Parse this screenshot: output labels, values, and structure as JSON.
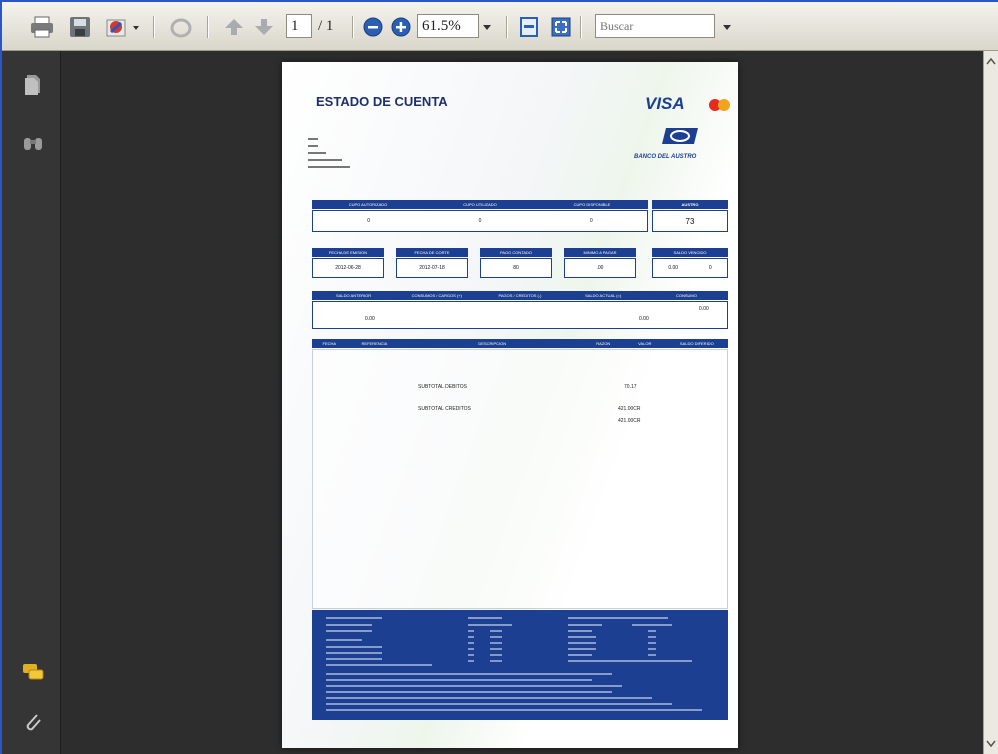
{
  "toolbar": {
    "page_current": "1",
    "page_total": "/ 1",
    "zoom": "61.5%",
    "search_placeholder": "Buscar"
  },
  "icons": {
    "print": "print-icon",
    "save": "save-icon",
    "sign": "sign-icon",
    "nav_prev": "arrow-up-icon",
    "nav_next": "arrow-down-icon",
    "zoom_out": "zoom-out-icon",
    "zoom_in": "zoom-in-icon",
    "fit_page": "fit-page-icon",
    "fullscreen": "fullscreen-icon",
    "pages": "pages-icon",
    "bookmarks": "binoculars-icon",
    "comments": "comments-icon",
    "attachments": "paperclip-icon"
  },
  "document": {
    "title": "ESTADO DE CUENTA",
    "brand_visa": "VISA",
    "bank_name": "BANCO DEL AUSTRO",
    "austro_label": "AUSTRO",
    "summary_headers": [
      "CUPO AUTORIZADO",
      "CUPO UTILIZADO",
      "CUPO DISPONIBLE"
    ],
    "summary_values": [
      "0",
      "0",
      "0"
    ],
    "points_value": "73",
    "dates_headers": [
      "FECHA DE EMISION",
      "FECHA DE CORTE",
      "PAGO CONTADO",
      "MINIMO A PAGAR",
      "SALDO VENCIDO"
    ],
    "dates_values": [
      "2012-06-28",
      "2012-07-18",
      "80",
      ".00",
      "0.00",
      "0"
    ],
    "balance_headers": [
      "SALDO ANTERIOR",
      "CONSUMOS / CARGOS (+)",
      "PAGOS / CREDITOS (-)",
      "SALDO ACTUAL (=)",
      "CONSUMO"
    ],
    "balance_values": [
      "0.00",
      "0.00",
      "0.00"
    ],
    "movements_headers": [
      "FECHA",
      "REFERENCIA",
      "DESCRIPCION",
      "RAZON",
      "VALOR",
      "SALDO DIFERIDO"
    ],
    "subtotal_debits_label": "SUBTOTAL DEBITOS",
    "subtotal_debits_value": "70.17",
    "subtotal_credits_label": "SUBTOTAL CREDITOS",
    "subtotal_credits_value": "421.00CR",
    "subtotal_credits_value2": "421.00CR"
  },
  "colors": {
    "frame": "#2a55c8",
    "doc_blue": "#1d3f91",
    "bg": "#2e2e2e"
  }
}
